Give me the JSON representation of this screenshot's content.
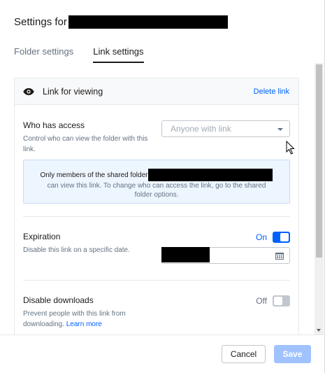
{
  "dialog": {
    "title_prefix": "Settings for"
  },
  "tabs": [
    {
      "label": "Folder settings",
      "active": false
    },
    {
      "label": "Link settings",
      "active": true
    }
  ],
  "link_panel": {
    "header_label": "Link for viewing",
    "delete_label": "Delete link",
    "eye_icon": "eye-icon"
  },
  "who_has_access": {
    "title": "Who has access",
    "description": "Control who can view the folder with this link.",
    "select_value": "Anyone with link",
    "info_part1": "Only members of the shared folder",
    "info_part2": "can view this link. To change who can access the link, go to the shared folder options."
  },
  "expiration": {
    "title": "Expiration",
    "description": "Disable this link on a specific date.",
    "toggle_label": "On",
    "toggle_state": "on",
    "calendar_icon": "calendar-icon"
  },
  "disable_downloads": {
    "title": "Disable downloads",
    "description": "Prevent people with this link from downloading.",
    "learn_more": "Learn more",
    "toggle_label": "Off",
    "toggle_state": "off"
  },
  "footer": {
    "cancel_label": "Cancel",
    "save_label": "Save"
  },
  "colors": {
    "accent": "#0061fe",
    "toggle_on": "#0061fe",
    "toggle_off": "#c1c7cd",
    "save_disabled": "#a0c3ff",
    "info_bg": "#edf5ff"
  }
}
